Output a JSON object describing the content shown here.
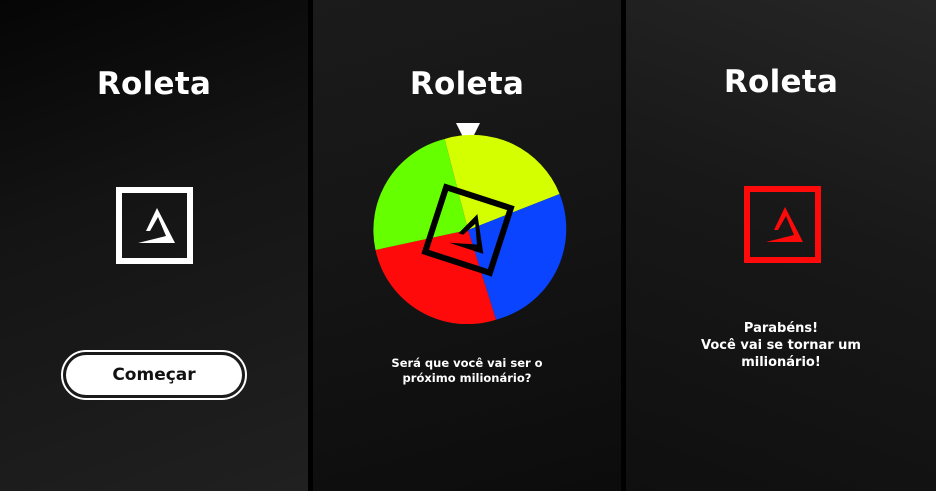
{
  "colors": {
    "brand_logo_white": "#ffffff",
    "brand_logo_red": "#ff0a0a",
    "wheel_yellow": "#d4ff00",
    "wheel_blue": "#0a44ff",
    "wheel_red": "#ff0a0a",
    "wheel_green": "#66ff00",
    "pointer": "#ffffff"
  },
  "screens": [
    {
      "title": "Roleta",
      "logo_icon": "brand-logo-icon",
      "start_button_label": "Começar"
    },
    {
      "title": "Roleta",
      "pointer_icon": "triangle-down-icon",
      "wheel_segments": [
        "yellow",
        "blue",
        "red",
        "green"
      ],
      "caption_line1": "Será que você vai ser o",
      "caption_line2": "próximo milionário?"
    },
    {
      "title": "Roleta",
      "logo_icon": "brand-logo-icon",
      "message_line1": "Parabéns!",
      "message_line2": "Você vai se tornar um",
      "message_line3": "milionário!"
    }
  ]
}
